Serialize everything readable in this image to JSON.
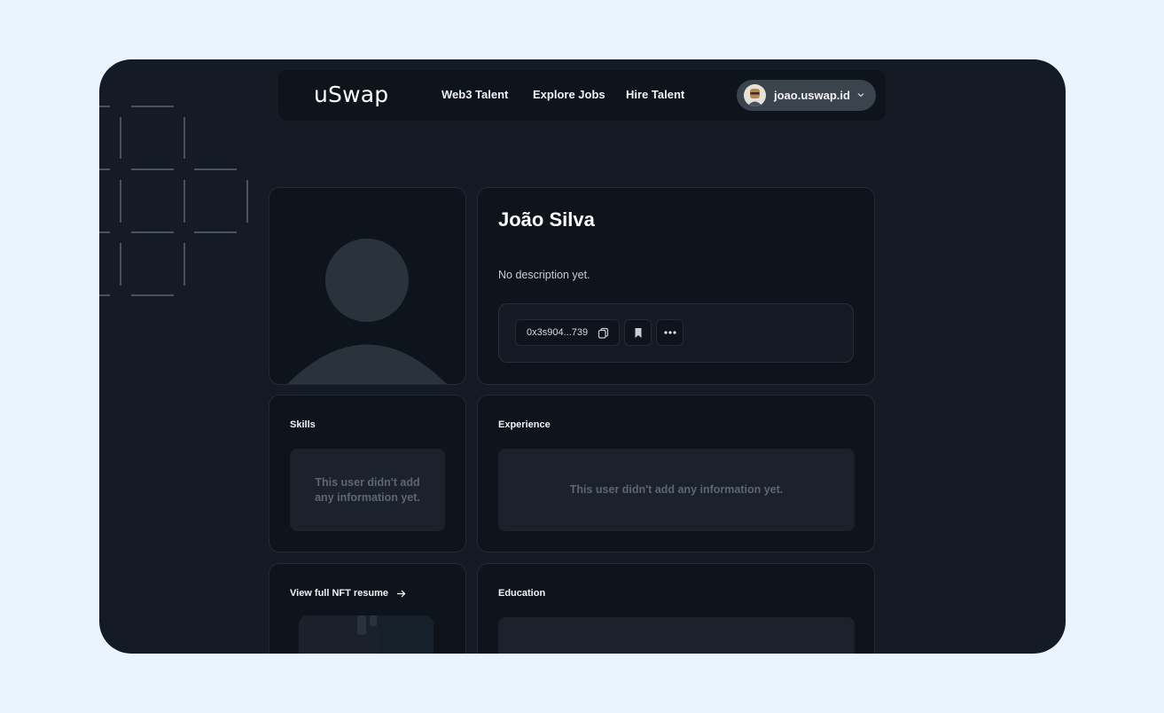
{
  "brand": {
    "logo_text": "uSwap"
  },
  "nav": {
    "links": [
      "Web3 Talent",
      "Explore Jobs",
      "Hire Talent"
    ],
    "user": {
      "name": "joao.uswap.id",
      "avatar_icon": "user-avatar-icon",
      "menu_icon": "chevron-down-icon"
    }
  },
  "profile": {
    "name": "João Silva",
    "description": "No description yet.",
    "wallet_address": "0x3s904...739",
    "actions": {
      "copy_icon": "copy-icon",
      "bookmark_icon": "bookmark-icon",
      "more_icon": "more-horizontal-icon"
    }
  },
  "skills": {
    "title": "Skills",
    "empty_text": "This user didn't add any information yet."
  },
  "experience": {
    "title": "Experience",
    "empty_text": "This user didn't add any information yet."
  },
  "nft_resume": {
    "link_text": "View full NFT resume",
    "link_icon": "arrow-right-icon"
  },
  "education": {
    "title": "Education"
  },
  "colors": {
    "page_bg": "#EAF4FE",
    "frame_bg": "#141B24",
    "card_bg": "#0E141C",
    "empty_box_bg": "#1B222C",
    "muted_text": "#5D6671"
  }
}
